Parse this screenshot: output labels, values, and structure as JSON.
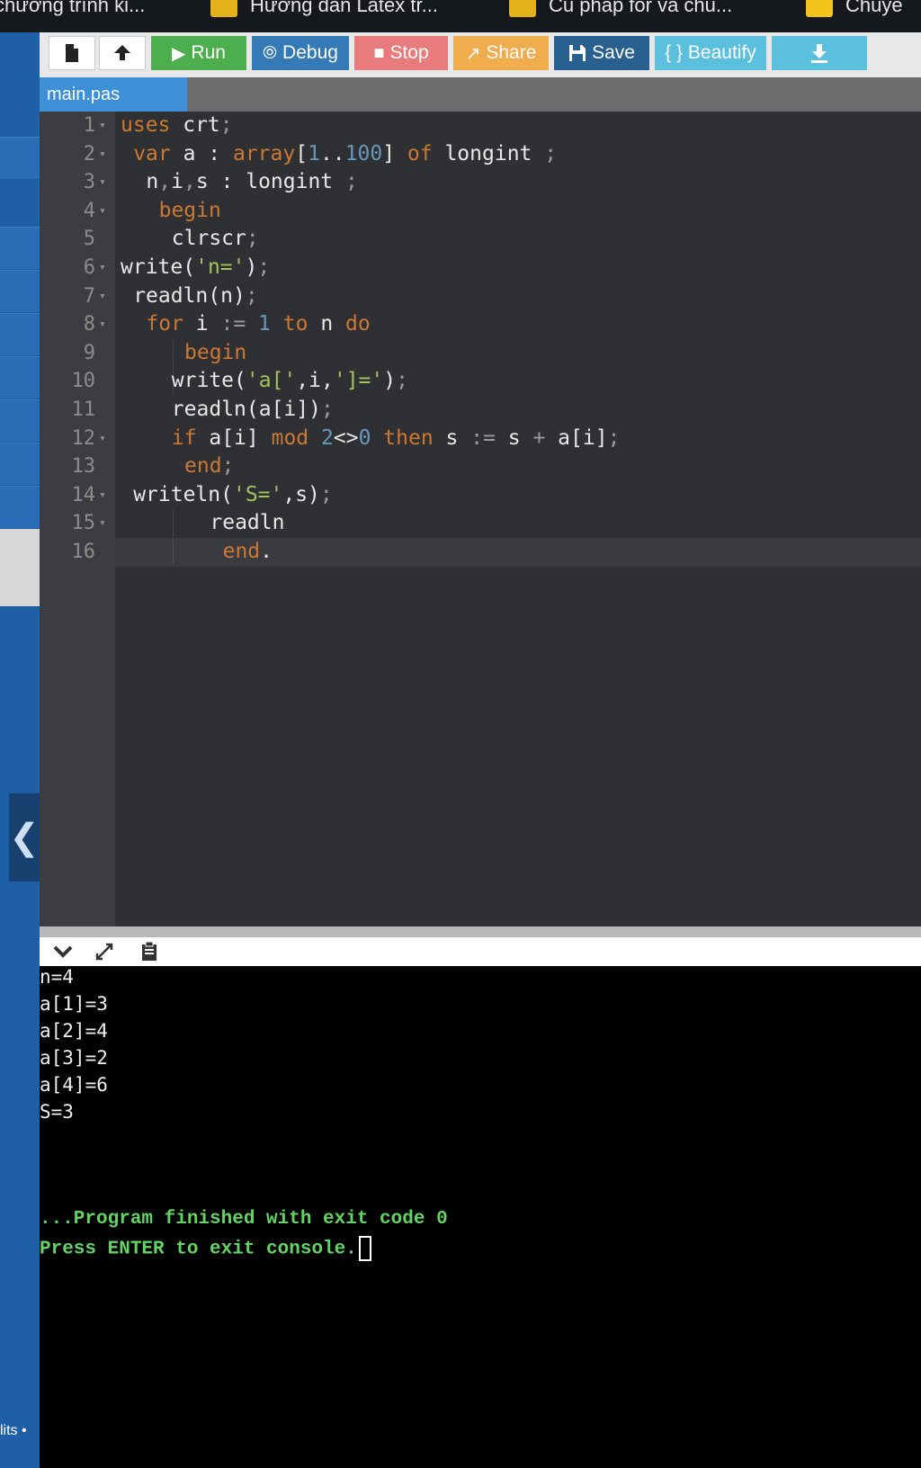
{
  "browser_tabs": [
    {
      "title": "chương trình ki..."
    },
    {
      "title": "Hướng dẫn Latex tr..."
    },
    {
      "title": "Cú pháp for và chu..."
    },
    {
      "title": "Chuyê"
    }
  ],
  "sidebar": {
    "bottom_text": "lits •"
  },
  "toolbar": {
    "new_icon": "file-icon",
    "upload_icon": "upload-icon",
    "run": "Run",
    "debug": "Debug",
    "stop": "Stop",
    "share": "Share",
    "save": "Save",
    "beautify": "{ } Beautify",
    "download_icon": "download-icon",
    "colors": {
      "run": "#4cae4c",
      "debug": "#337ab7",
      "stop": "#e87c7c",
      "share": "#f0ad4e",
      "save": "#286090",
      "beautify": "#5bc0de",
      "download": "#5bc0de"
    }
  },
  "file_tab": {
    "name": "main.pas"
  },
  "editor": {
    "current_line": 16,
    "lines": [
      {
        "n": "1",
        "fold": true,
        "indent": 0,
        "tokens": [
          [
            "kw",
            "uses"
          ],
          [
            "t",
            " crt"
          ],
          [
            "op",
            ";"
          ]
        ]
      },
      {
        "n": "2",
        "fold": true,
        "indent": 1,
        "tokens": [
          [
            "kw",
            "var"
          ],
          [
            "t",
            " a : "
          ],
          [
            "kw",
            "array"
          ],
          [
            "t",
            "["
          ],
          [
            "num",
            "1"
          ],
          [
            "t",
            ".."
          ],
          [
            "num",
            "100"
          ],
          [
            "t",
            "] "
          ],
          [
            "kw",
            "of"
          ],
          [
            "t",
            " longint "
          ],
          [
            "op",
            ";"
          ]
        ]
      },
      {
        "n": "3",
        "fold": true,
        "indent": 2,
        "tokens": [
          [
            "t",
            "n"
          ],
          [
            "op",
            ","
          ],
          [
            "t",
            "i"
          ],
          [
            "op",
            ","
          ],
          [
            "t",
            "s : longint "
          ],
          [
            "op",
            ";"
          ]
        ]
      },
      {
        "n": "4",
        "fold": true,
        "indent": 3,
        "tokens": [
          [
            "kw",
            "begin"
          ]
        ]
      },
      {
        "n": "5",
        "fold": false,
        "indent": 4,
        "tokens": [
          [
            "t",
            "clrscr"
          ],
          [
            "op",
            ";"
          ]
        ]
      },
      {
        "n": "6",
        "fold": true,
        "indent": 0,
        "tokens": [
          [
            "t",
            "write("
          ],
          [
            "str",
            "'n='"
          ],
          [
            "t",
            ")"
          ],
          [
            "op",
            ";"
          ]
        ]
      },
      {
        "n": "7",
        "fold": true,
        "indent": 1,
        "tokens": [
          [
            "t",
            "readln(n)"
          ],
          [
            "op",
            ";"
          ]
        ]
      },
      {
        "n": "8",
        "fold": true,
        "indent": 2,
        "tokens": [
          [
            "kw",
            "for"
          ],
          [
            "t",
            " i "
          ],
          [
            "op",
            ":="
          ],
          [
            "t",
            " "
          ],
          [
            "num",
            "1"
          ],
          [
            "t",
            " "
          ],
          [
            "kw",
            "to"
          ],
          [
            "t",
            " n "
          ],
          [
            "kw",
            "do"
          ]
        ]
      },
      {
        "n": "9",
        "fold": false,
        "indent": 5,
        "tokens": [
          [
            "kw",
            "begin"
          ]
        ]
      },
      {
        "n": "10",
        "fold": false,
        "indent": 4,
        "tokens": [
          [
            "t",
            "write("
          ],
          [
            "str",
            "'a['"
          ],
          [
            "t",
            ","
          ],
          [
            "t",
            "i"
          ],
          [
            "t",
            ","
          ],
          [
            "str",
            "']='"
          ],
          [
            "t",
            ")"
          ],
          [
            "op",
            ";"
          ]
        ]
      },
      {
        "n": "11",
        "fold": false,
        "indent": 4,
        "tokens": [
          [
            "t",
            "readln(a[i])"
          ],
          [
            "op",
            ";"
          ]
        ]
      },
      {
        "n": "12",
        "fold": true,
        "indent": 4,
        "tokens": [
          [
            "kw",
            "if"
          ],
          [
            "t",
            " a[i] "
          ],
          [
            "kw",
            "mod"
          ],
          [
            "t",
            " "
          ],
          [
            "num",
            "2"
          ],
          [
            "t",
            "<>"
          ],
          [
            "num",
            "0"
          ],
          [
            "t",
            " "
          ],
          [
            "kw",
            "then"
          ],
          [
            "t",
            " s "
          ],
          [
            "op",
            ":="
          ],
          [
            "t",
            " s "
          ],
          [
            "op",
            "+"
          ],
          [
            "t",
            " a[i]"
          ],
          [
            "op",
            ";"
          ]
        ]
      },
      {
        "n": "13",
        "fold": false,
        "indent": 5,
        "tokens": [
          [
            "kw",
            "end"
          ],
          [
            "op",
            ";"
          ]
        ]
      },
      {
        "n": "14",
        "fold": true,
        "indent": 1,
        "tokens": [
          [
            "t",
            "writeln("
          ],
          [
            "str",
            "'S='"
          ],
          [
            "t",
            ",s)"
          ],
          [
            "op",
            ";"
          ]
        ]
      },
      {
        "n": "15",
        "fold": true,
        "indent": 7,
        "tokens": [
          [
            "t",
            "readln"
          ]
        ]
      },
      {
        "n": "16",
        "fold": false,
        "indent": 8,
        "tokens": [
          [
            "kw",
            "end"
          ],
          [
            "t",
            "."
          ]
        ]
      }
    ]
  },
  "console_bar": {
    "collapse_icon": "chevron-down-icon",
    "expand_icon": "expand-icon",
    "copy_icon": "clipboard-icon"
  },
  "console": {
    "lines": [
      "n=4",
      "a[1]=3",
      "a[2]=4",
      "a[3]=2",
      "a[4]=6",
      "S=3"
    ],
    "finish": "...Program finished with exit code 0",
    "press": "Press ENTER to exit console."
  }
}
